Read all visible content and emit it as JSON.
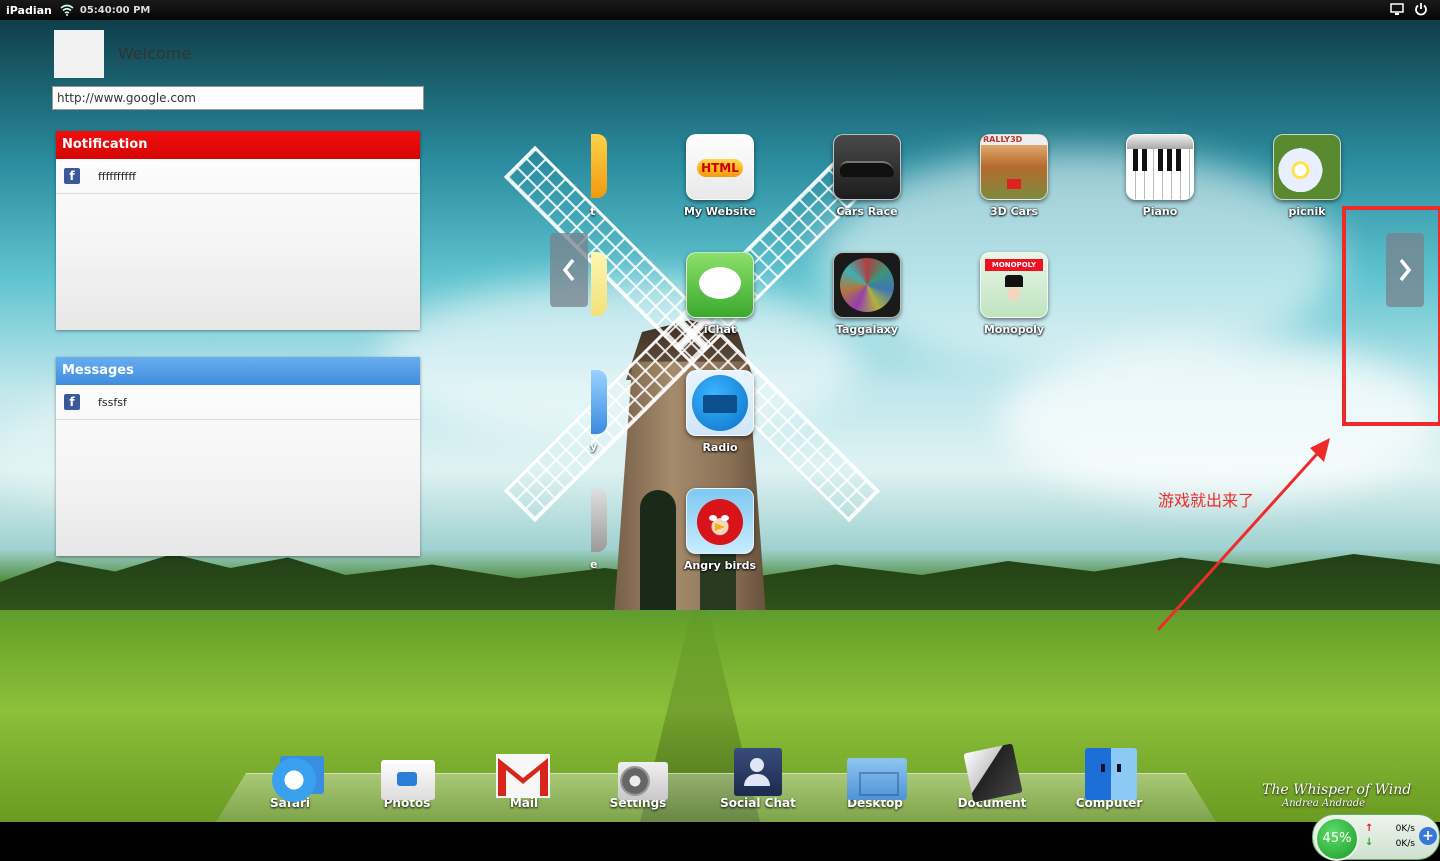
{
  "statusbar": {
    "brand": "iPadian",
    "time": "05:40:00 PM"
  },
  "left": {
    "welcome": "Welcome",
    "url_value": "http://www.google.com",
    "notification": {
      "title": "Notification",
      "items": [
        {
          "text": "ffffffffff"
        }
      ],
      "color": "#e50b0b"
    },
    "messages": {
      "title": "Messages",
      "items": [
        {
          "text": "fssfsf"
        }
      ],
      "color": "#4f9be8"
    }
  },
  "apps": [
    {
      "label": "My Website"
    },
    {
      "label": "Cars Race"
    },
    {
      "label": "3D Cars"
    },
    {
      "label": "Piano"
    },
    {
      "label": "picnik"
    },
    {
      "label": "iChat"
    },
    {
      "label": "Taggalaxy"
    },
    {
      "label": "Monopoly"
    },
    {
      "label": "Radio"
    },
    {
      "label": "Angry birds"
    }
  ],
  "partial_labels": [
    "t",
    "y",
    "e"
  ],
  "annotation": {
    "text": "游戏就出来了",
    "color": "#ee2b2b"
  },
  "dock": [
    {
      "label": "Safari"
    },
    {
      "label": "Photos"
    },
    {
      "label": "Mail"
    },
    {
      "label": "Settings"
    },
    {
      "label": "Social Chat"
    },
    {
      "label": "Desktop"
    },
    {
      "label": "Document"
    },
    {
      "label": "Computer"
    }
  ],
  "signature": {
    "line1": "The Whisper of Wind",
    "line2": "Andrea Andrade"
  },
  "widget": {
    "cpu": "45%",
    "up_speed": "0K/s",
    "down_speed": "0K/s"
  }
}
